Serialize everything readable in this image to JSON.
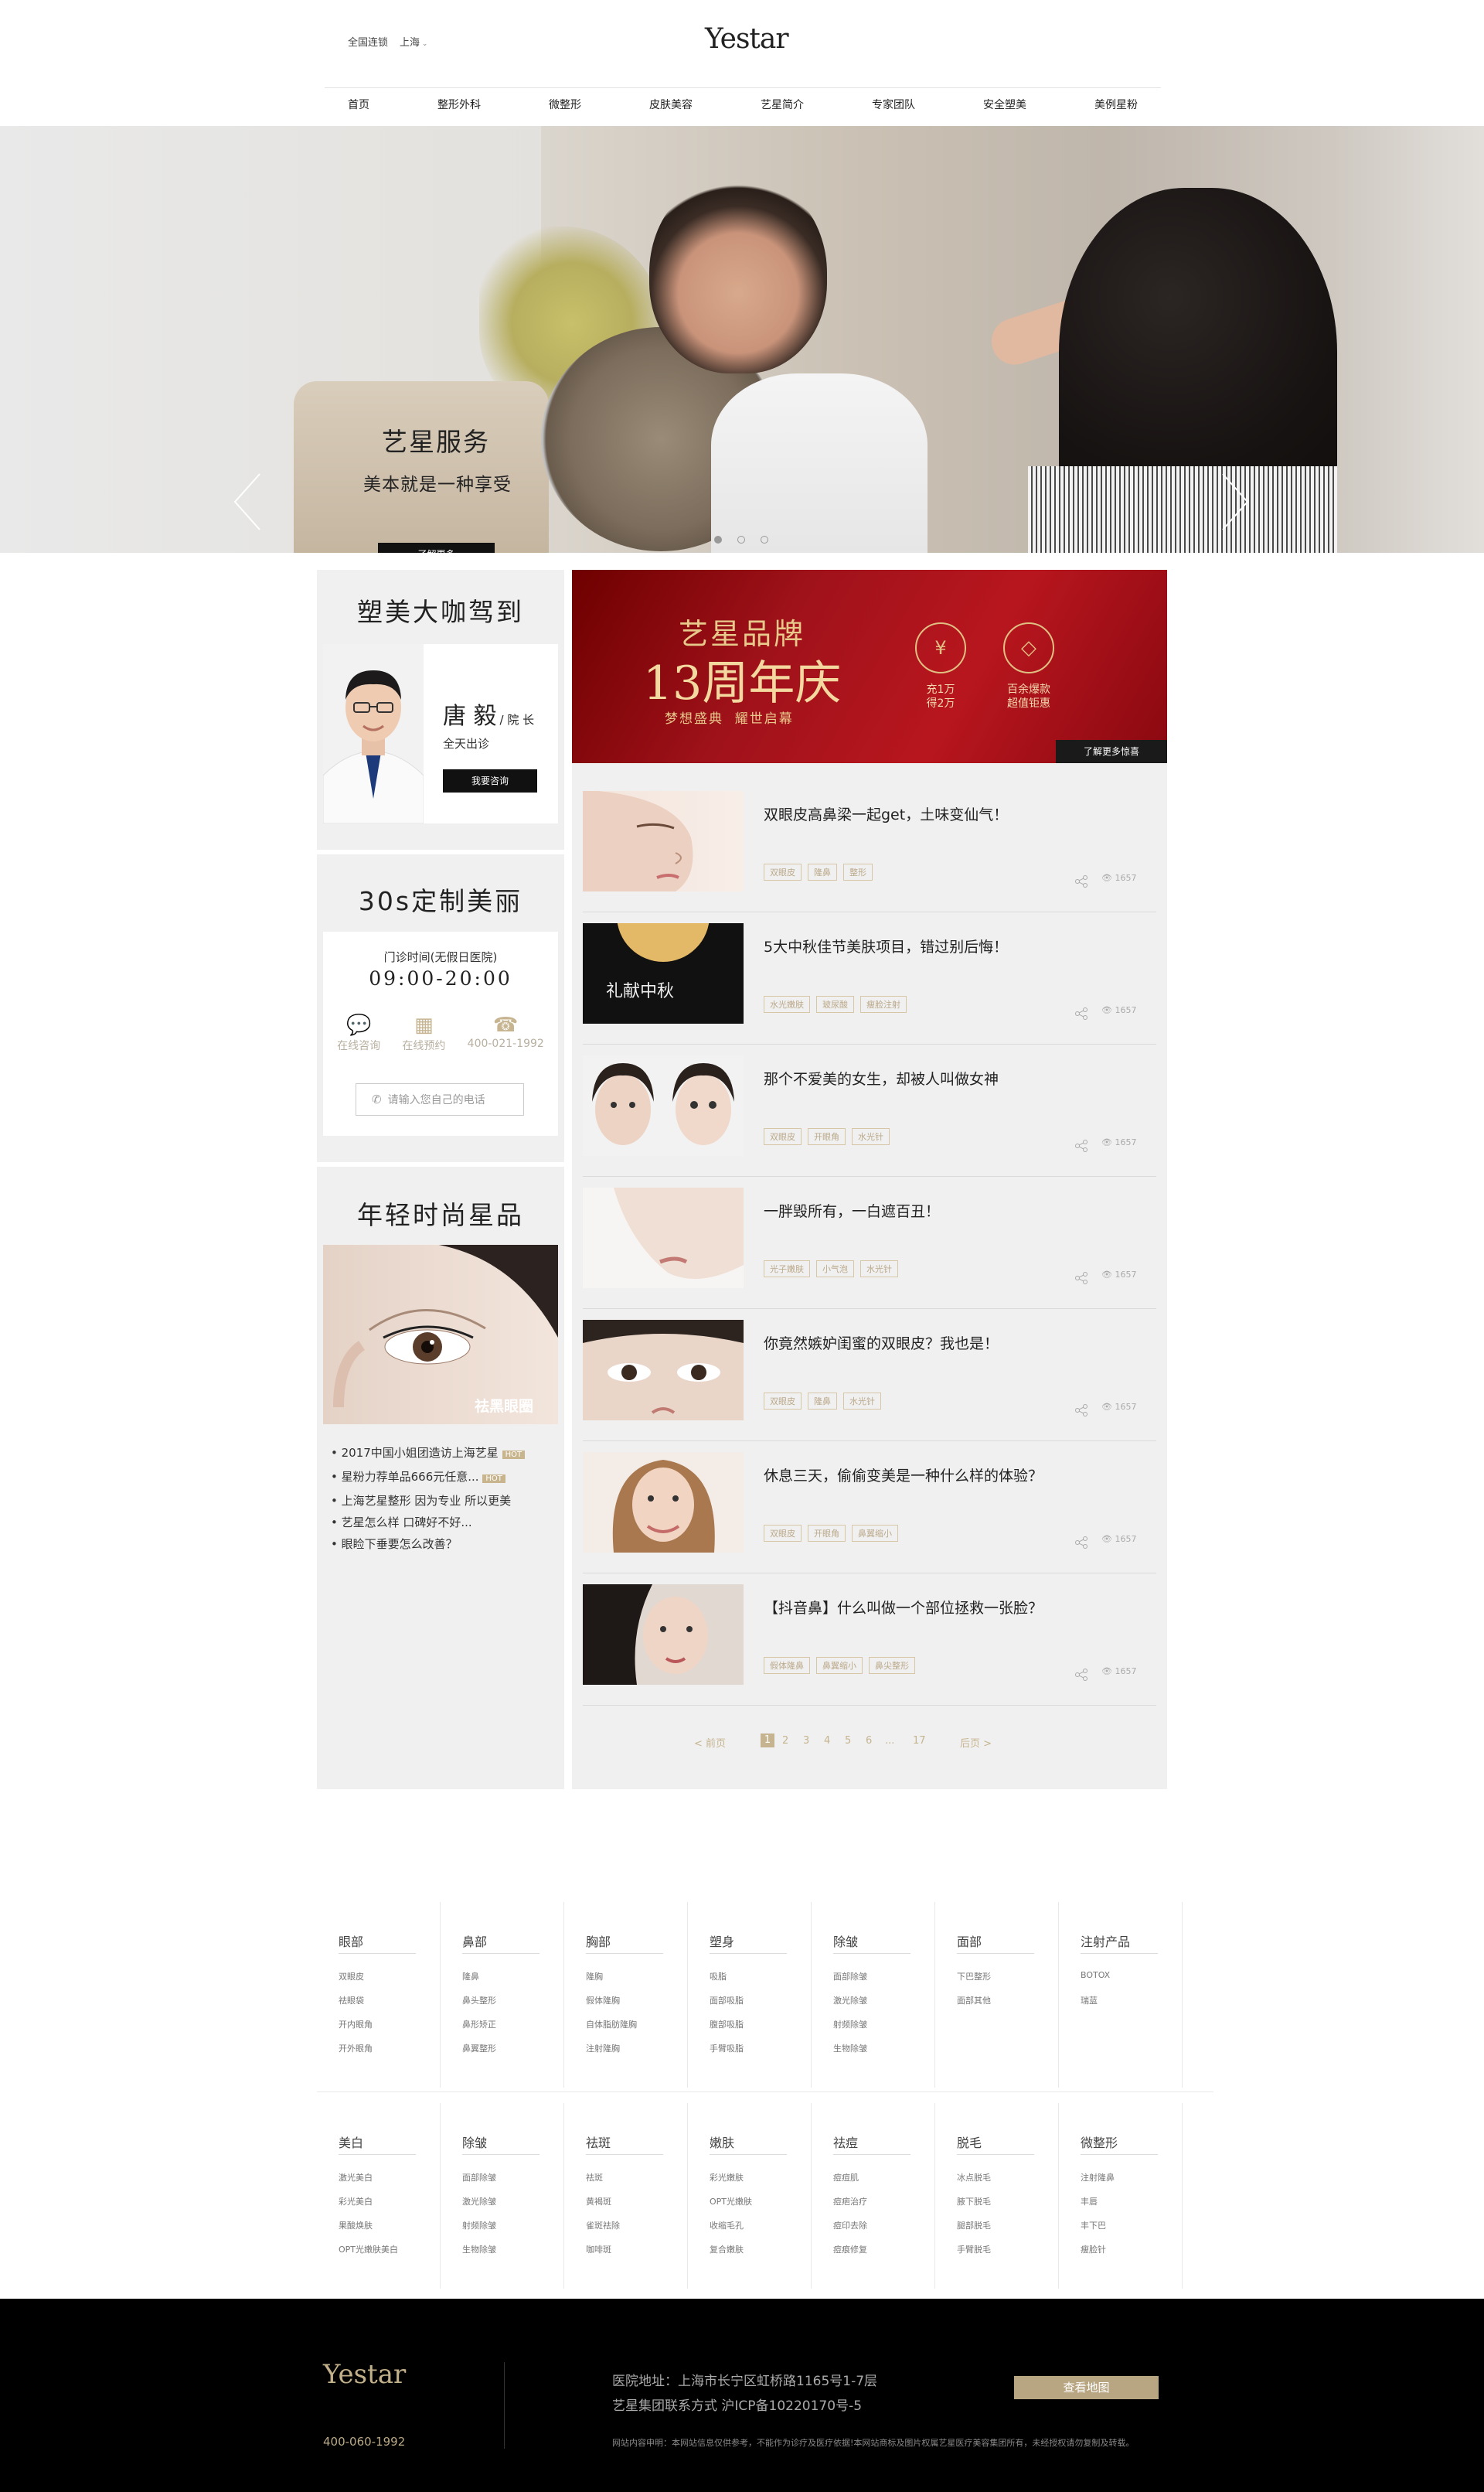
{
  "header": {
    "city_label": "全国连锁",
    "city_selected": "上海",
    "logo": "Yestar",
    "nav": [
      "首页",
      "整形外科",
      "微整形",
      "皮肤美容",
      "艺星简介",
      "专家团队",
      "安全塑美",
      "美例星粉"
    ]
  },
  "banner": {
    "title": "艺星服务",
    "subtitle": "美本就是一种享受",
    "button": "了解更多",
    "dots": 3
  },
  "expert": {
    "heading": "塑美大咖驾到",
    "name": "唐 毅",
    "title": "/ 院 长",
    "availability": "全天出诊",
    "button": "我要咨询"
  },
  "custom": {
    "heading": "30s定制美丽",
    "hours_label": "门诊时间(无假日医院)",
    "hours": "09:00-20:00",
    "actions": [
      "在线咨询",
      "在线预约",
      "400-021-1992"
    ],
    "phone_placeholder": "请输入您自己的电话"
  },
  "products": {
    "heading": "年轻时尚星品",
    "image_caption": "祛黑眼圈",
    "hot_badge": "HOT",
    "links": [
      "2017中国小姐团造访上海艺星",
      "星粉力荐单品666元任意...",
      "上海艺星整形 因为专业 所以更美",
      "艺星怎么样 口碑好不好...",
      "眼睑下垂要怎么改善？"
    ]
  },
  "promo": {
    "brand_line": "艺星品牌",
    "anniversary": "13周年庆",
    "slogan": "梦想盛典  耀世启幕",
    "badge1_icon": "¥",
    "badge1": [
      "充1万",
      "得2万"
    ],
    "badge2": [
      "百余爆款",
      "超值钜惠"
    ],
    "button": "了解更多惊喜"
  },
  "articles": [
    {
      "title": "双眼皮高鼻梁一起get，土味变仙气！",
      "tags": [
        "双眼皮",
        "隆鼻",
        "整形"
      ],
      "views": "1657"
    },
    {
      "title": "5大中秋佳节美肤项目，错过别后悔！",
      "tags": [
        "水光嫩肤",
        "玻尿酸",
        "瘦脸注射"
      ],
      "views": "1657",
      "thumb_text": "礼献中秋"
    },
    {
      "title": "那个不爱美的女生，却被人叫做女神",
      "tags": [
        "双眼皮",
        "开眼角",
        "水光针"
      ],
      "views": "1657"
    },
    {
      "title": "一胖毁所有，一白遮百丑！",
      "tags": [
        "光子嫩肤",
        "小气泡",
        "水光针"
      ],
      "views": "1657"
    },
    {
      "title": "你竟然嫉妒闺蜜的双眼皮？我也是！",
      "tags": [
        "双眼皮",
        "隆鼻",
        "水光针"
      ],
      "views": "1657"
    },
    {
      "title": "休息三天，偷偷变美是一种什么样的体验？",
      "tags": [
        "双眼皮",
        "开眼角",
        "鼻翼缩小"
      ],
      "views": "1657"
    },
    {
      "title": "【抖音鼻】什么叫做一个部位拯救一张脸？",
      "tags": [
        "假体隆鼻",
        "鼻翼缩小",
        "鼻尖整形"
      ],
      "views": "1657"
    }
  ],
  "pagination": {
    "prev": "< 前页",
    "pages": [
      "1",
      "2",
      "3",
      "4",
      "5",
      "6",
      "...",
      "17"
    ],
    "next": "后页 >"
  },
  "categories_row1": [
    {
      "title": "眼部",
      "items": [
        "双眼皮",
        "祛眼袋",
        "开内眼角",
        "开外眼角"
      ]
    },
    {
      "title": "鼻部",
      "items": [
        "隆鼻",
        "鼻头整形",
        "鼻形矫正",
        "鼻翼整形"
      ]
    },
    {
      "title": "胸部",
      "items": [
        "隆胸",
        "假体隆胸",
        "自体脂肪隆胸",
        "注射隆胸"
      ]
    },
    {
      "title": "塑身",
      "items": [
        "吸脂",
        "面部吸脂",
        "腹部吸脂",
        "手臂吸脂"
      ]
    },
    {
      "title": "除皱",
      "items": [
        "面部除皱",
        "激光除皱",
        "射频除皱",
        "生物除皱"
      ]
    },
    {
      "title": "面部",
      "items": [
        "下巴整形",
        "面部其他"
      ]
    },
    {
      "title": "注射产品",
      "items": [
        "BOTOX",
        "瑞蓝"
      ]
    }
  ],
  "categories_row2": [
    {
      "title": "美白",
      "items": [
        "激光美白",
        "彩光美白",
        "果酸焕肤",
        "OPT光嫩肤美白"
      ]
    },
    {
      "title": "除皱",
      "items": [
        "面部除皱",
        "激光除皱",
        "射频除皱",
        "生物除皱"
      ]
    },
    {
      "title": "祛斑",
      "items": [
        "祛斑",
        "黄褐斑",
        "雀斑祛除",
        "咖啡斑"
      ]
    },
    {
      "title": "嫩肤",
      "items": [
        "彩光嫩肤",
        "OPT光嫩肤",
        "收缩毛孔",
        "复合嫩肤"
      ]
    },
    {
      "title": "祛痘",
      "items": [
        "痘痘肌",
        "痘疤治疗",
        "痘印去除",
        "痘痕修复"
      ]
    },
    {
      "title": "脱毛",
      "items": [
        "冰点脱毛",
        "腋下脱毛",
        "腿部脱毛",
        "手臂脱毛"
      ]
    },
    {
      "title": "微整形",
      "items": [
        "注射隆鼻",
        "丰唇",
        "丰下巴",
        "瘦脸针"
      ]
    }
  ],
  "footer": {
    "logo": "Yestar",
    "phone": "400-060-1992",
    "address": "医院地址：上海市长宁区虹桥路1165号1-7层",
    "company": "艺星集团联系方式 沪ICP备10220170号-5",
    "disclaimer": "网站内容申明：本网站信息仅供参考，不能作为诊疗及医疗依据!本网站商标及图片权属艺星医疗美容集团所有，未经授权请勿复制及转载。",
    "map_button": "查看地图"
  },
  "colors": {
    "accent_gold": "#b8a682",
    "promo_red": "#a0121a",
    "footer_bg": "#000000"
  }
}
